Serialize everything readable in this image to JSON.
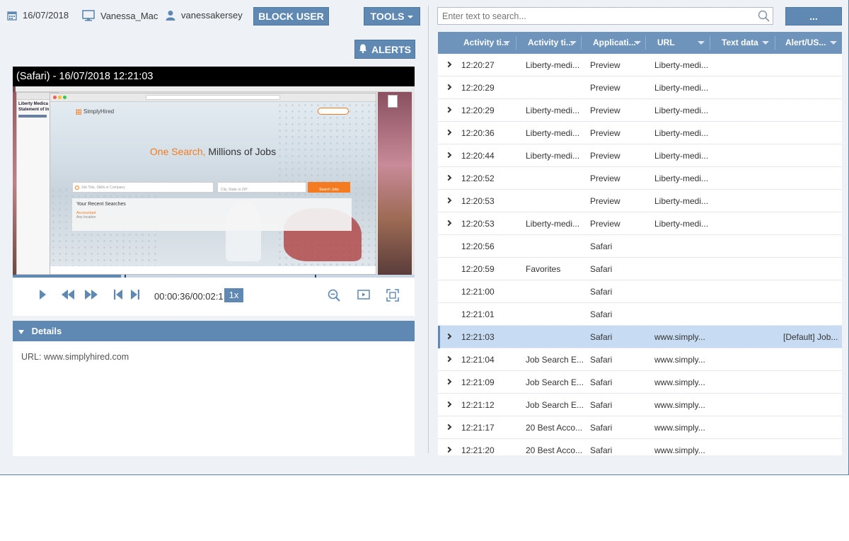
{
  "header": {
    "date": "16/07/2018",
    "computer": "Vanessa_Mac",
    "user": "vanessakersey",
    "block_user_label": "BLOCK USER",
    "tools_label": "TOOLS",
    "alerts_label": "ALERTS"
  },
  "player": {
    "title": "(Safari) - 16/07/2018 12:21:03",
    "time": "00:00:36/00:02:1",
    "speed": "1x",
    "progress_fraction": 0.27
  },
  "screenshot": {
    "brand": "SimplyHired",
    "headline_accent": "One Search,",
    "headline_rest": "Millions of Jobs",
    "job_placeholder": "Job Title, Skills or Company",
    "location_placeholder": "City, State or ZIP",
    "search_button": "Search Jobs",
    "recent_title": "Your Recent Searches",
    "recent_item": "Accountant",
    "recent_sub": "Any location",
    "left_doc_line1": "Liberty Medica",
    "left_doc_line2": "Statement of In"
  },
  "details": {
    "title": "Details",
    "url_text": "URL: www.simplyhired.com"
  },
  "search": {
    "placeholder": "Enter text to search...",
    "more_label": "..."
  },
  "grid": {
    "columns": [
      "Activity ti...",
      "Activity ti...",
      "Applicati...",
      "URL",
      "Text data",
      "Alert/US..."
    ],
    "rows": [
      {
        "time": "12:20:27",
        "title": "Liberty-medi...",
        "app": "Preview",
        "url": "Liberty-medi...",
        "text": "",
        "alert": "",
        "expand": true,
        "selected": false
      },
      {
        "time": "12:20:29",
        "title": "",
        "app": "Preview",
        "url": "Liberty-medi...",
        "text": "",
        "alert": "",
        "expand": true,
        "selected": false
      },
      {
        "time": "12:20:29",
        "title": "Liberty-medi...",
        "app": "Preview",
        "url": "Liberty-medi...",
        "text": "",
        "alert": "",
        "expand": true,
        "selected": false
      },
      {
        "time": "12:20:36",
        "title": "Liberty-medi...",
        "app": "Preview",
        "url": "Liberty-medi...",
        "text": "",
        "alert": "",
        "expand": true,
        "selected": false
      },
      {
        "time": "12:20:44",
        "title": "Liberty-medi...",
        "app": "Preview",
        "url": "Liberty-medi...",
        "text": "",
        "alert": "",
        "expand": true,
        "selected": false
      },
      {
        "time": "12:20:52",
        "title": "",
        "app": "Preview",
        "url": "Liberty-medi...",
        "text": "",
        "alert": "",
        "expand": true,
        "selected": false
      },
      {
        "time": "12:20:53",
        "title": "",
        "app": "Preview",
        "url": "Liberty-medi...",
        "text": "",
        "alert": "",
        "expand": true,
        "selected": false
      },
      {
        "time": "12:20:53",
        "title": "Liberty-medi...",
        "app": "Preview",
        "url": "Liberty-medi...",
        "text": "",
        "alert": "",
        "expand": true,
        "selected": false
      },
      {
        "time": "12:20:56",
        "title": "",
        "app": "Safari",
        "url": "",
        "text": "",
        "alert": "",
        "expand": false,
        "selected": false
      },
      {
        "time": "12:20:59",
        "title": "Favorites",
        "app": "Safari",
        "url": "",
        "text": "",
        "alert": "",
        "expand": false,
        "selected": false
      },
      {
        "time": "12:21:00",
        "title": "",
        "app": "Safari",
        "url": "",
        "text": "",
        "alert": "",
        "expand": false,
        "selected": false
      },
      {
        "time": "12:21:01",
        "title": "",
        "app": "Safari",
        "url": "",
        "text": "",
        "alert": "",
        "expand": false,
        "selected": false
      },
      {
        "time": "12:21:03",
        "title": "",
        "app": "Safari",
        "url": "www.simply...",
        "text": "",
        "alert": "[Default] Job...",
        "expand": true,
        "selected": true
      },
      {
        "time": "12:21:04",
        "title": "Job Search E...",
        "app": "Safari",
        "url": "www.simply...",
        "text": "",
        "alert": "",
        "expand": true,
        "selected": false
      },
      {
        "time": "12:21:09",
        "title": "Job Search E...",
        "app": "Safari",
        "url": "www.simply...",
        "text": "",
        "alert": "",
        "expand": true,
        "selected": false
      },
      {
        "time": "12:21:12",
        "title": "Job Search E...",
        "app": "Safari",
        "url": "www.simply...",
        "text": "",
        "alert": "",
        "expand": true,
        "selected": false
      },
      {
        "time": "12:21:17",
        "title": "20 Best Acco...",
        "app": "Safari",
        "url": "www.simply...",
        "text": "",
        "alert": "",
        "expand": true,
        "selected": false
      },
      {
        "time": "12:21:20",
        "title": "20 Best Acco...",
        "app": "Safari",
        "url": "www.simply...",
        "text": "",
        "alert": "",
        "expand": true,
        "selected": false
      }
    ]
  },
  "colors": {
    "accent": "#5f88b2",
    "grid_header": "#6e94bb",
    "selected_row": "#c7dcf3",
    "brand_orange": "#f47b20"
  }
}
